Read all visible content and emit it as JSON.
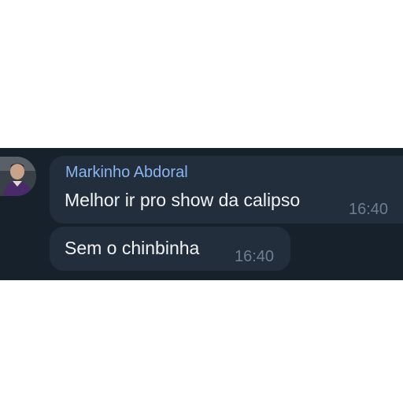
{
  "chat": {
    "messages": [
      {
        "sender": "Markinho Abdoral",
        "text": "Melhor ir pro show da calipso",
        "time": "16:40"
      },
      {
        "text": "Sem o chinbinha",
        "time": "16:40"
      }
    ]
  },
  "colors": {
    "background": "#17212b",
    "bubble": "#232e3c",
    "sender_name": "#8ab4f0",
    "message_text": "#f1f4f7",
    "timestamp": "#6d7f8f"
  },
  "icons": {
    "avatar": "user-avatar-photo"
  }
}
